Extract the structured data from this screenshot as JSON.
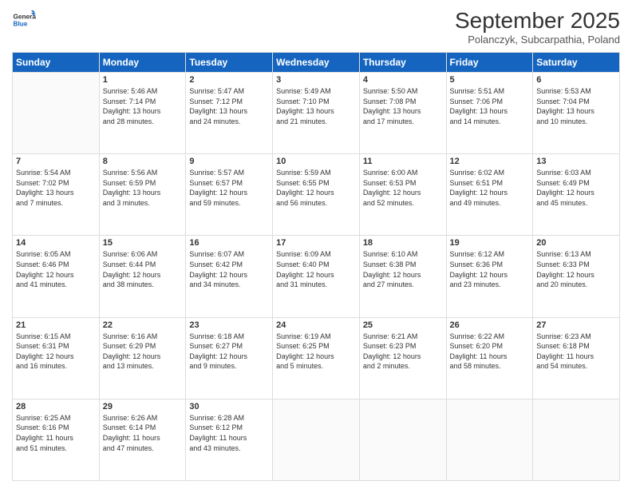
{
  "header": {
    "logo_general": "General",
    "logo_blue": "Blue",
    "month_title": "September 2025",
    "location": "Polanczyk, Subcarpathia, Poland"
  },
  "weekdays": [
    "Sunday",
    "Monday",
    "Tuesday",
    "Wednesday",
    "Thursday",
    "Friday",
    "Saturday"
  ],
  "weeks": [
    [
      {
        "day": "",
        "info": ""
      },
      {
        "day": "1",
        "info": "Sunrise: 5:46 AM\nSunset: 7:14 PM\nDaylight: 13 hours\nand 28 minutes."
      },
      {
        "day": "2",
        "info": "Sunrise: 5:47 AM\nSunset: 7:12 PM\nDaylight: 13 hours\nand 24 minutes."
      },
      {
        "day": "3",
        "info": "Sunrise: 5:49 AM\nSunset: 7:10 PM\nDaylight: 13 hours\nand 21 minutes."
      },
      {
        "day": "4",
        "info": "Sunrise: 5:50 AM\nSunset: 7:08 PM\nDaylight: 13 hours\nand 17 minutes."
      },
      {
        "day": "5",
        "info": "Sunrise: 5:51 AM\nSunset: 7:06 PM\nDaylight: 13 hours\nand 14 minutes."
      },
      {
        "day": "6",
        "info": "Sunrise: 5:53 AM\nSunset: 7:04 PM\nDaylight: 13 hours\nand 10 minutes."
      }
    ],
    [
      {
        "day": "7",
        "info": "Sunrise: 5:54 AM\nSunset: 7:02 PM\nDaylight: 13 hours\nand 7 minutes."
      },
      {
        "day": "8",
        "info": "Sunrise: 5:56 AM\nSunset: 6:59 PM\nDaylight: 13 hours\nand 3 minutes."
      },
      {
        "day": "9",
        "info": "Sunrise: 5:57 AM\nSunset: 6:57 PM\nDaylight: 12 hours\nand 59 minutes."
      },
      {
        "day": "10",
        "info": "Sunrise: 5:59 AM\nSunset: 6:55 PM\nDaylight: 12 hours\nand 56 minutes."
      },
      {
        "day": "11",
        "info": "Sunrise: 6:00 AM\nSunset: 6:53 PM\nDaylight: 12 hours\nand 52 minutes."
      },
      {
        "day": "12",
        "info": "Sunrise: 6:02 AM\nSunset: 6:51 PM\nDaylight: 12 hours\nand 49 minutes."
      },
      {
        "day": "13",
        "info": "Sunrise: 6:03 AM\nSunset: 6:49 PM\nDaylight: 12 hours\nand 45 minutes."
      }
    ],
    [
      {
        "day": "14",
        "info": "Sunrise: 6:05 AM\nSunset: 6:46 PM\nDaylight: 12 hours\nand 41 minutes."
      },
      {
        "day": "15",
        "info": "Sunrise: 6:06 AM\nSunset: 6:44 PM\nDaylight: 12 hours\nand 38 minutes."
      },
      {
        "day": "16",
        "info": "Sunrise: 6:07 AM\nSunset: 6:42 PM\nDaylight: 12 hours\nand 34 minutes."
      },
      {
        "day": "17",
        "info": "Sunrise: 6:09 AM\nSunset: 6:40 PM\nDaylight: 12 hours\nand 31 minutes."
      },
      {
        "day": "18",
        "info": "Sunrise: 6:10 AM\nSunset: 6:38 PM\nDaylight: 12 hours\nand 27 minutes."
      },
      {
        "day": "19",
        "info": "Sunrise: 6:12 AM\nSunset: 6:36 PM\nDaylight: 12 hours\nand 23 minutes."
      },
      {
        "day": "20",
        "info": "Sunrise: 6:13 AM\nSunset: 6:33 PM\nDaylight: 12 hours\nand 20 minutes."
      }
    ],
    [
      {
        "day": "21",
        "info": "Sunrise: 6:15 AM\nSunset: 6:31 PM\nDaylight: 12 hours\nand 16 minutes."
      },
      {
        "day": "22",
        "info": "Sunrise: 6:16 AM\nSunset: 6:29 PM\nDaylight: 12 hours\nand 13 minutes."
      },
      {
        "day": "23",
        "info": "Sunrise: 6:18 AM\nSunset: 6:27 PM\nDaylight: 12 hours\nand 9 minutes."
      },
      {
        "day": "24",
        "info": "Sunrise: 6:19 AM\nSunset: 6:25 PM\nDaylight: 12 hours\nand 5 minutes."
      },
      {
        "day": "25",
        "info": "Sunrise: 6:21 AM\nSunset: 6:23 PM\nDaylight: 12 hours\nand 2 minutes."
      },
      {
        "day": "26",
        "info": "Sunrise: 6:22 AM\nSunset: 6:20 PM\nDaylight: 11 hours\nand 58 minutes."
      },
      {
        "day": "27",
        "info": "Sunrise: 6:23 AM\nSunset: 6:18 PM\nDaylight: 11 hours\nand 54 minutes."
      }
    ],
    [
      {
        "day": "28",
        "info": "Sunrise: 6:25 AM\nSunset: 6:16 PM\nDaylight: 11 hours\nand 51 minutes."
      },
      {
        "day": "29",
        "info": "Sunrise: 6:26 AM\nSunset: 6:14 PM\nDaylight: 11 hours\nand 47 minutes."
      },
      {
        "day": "30",
        "info": "Sunrise: 6:28 AM\nSunset: 6:12 PM\nDaylight: 11 hours\nand 43 minutes."
      },
      {
        "day": "",
        "info": ""
      },
      {
        "day": "",
        "info": ""
      },
      {
        "day": "",
        "info": ""
      },
      {
        "day": "",
        "info": ""
      }
    ]
  ]
}
